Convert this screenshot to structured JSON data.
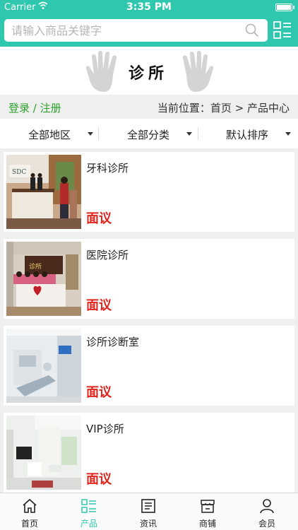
{
  "status_bar": {
    "carrier": "Carrier",
    "time": "3:35 PM"
  },
  "search": {
    "placeholder": "请输入商品关键字"
  },
  "banner": {
    "title": "诊所"
  },
  "breadcrumb": {
    "login_link": "登录",
    "separator": " / ",
    "register_link": "注册",
    "location": "当前位置：首页 > 产品中心"
  },
  "filters": [
    {
      "label": "全部地区"
    },
    {
      "label": "全部分类"
    },
    {
      "label": "默认排序"
    }
  ],
  "products": [
    {
      "name": "牙科诊所",
      "price": "面议"
    },
    {
      "name": "医院诊所",
      "price": "面议"
    },
    {
      "name": "诊所诊断室",
      "price": "面议"
    },
    {
      "name": "VIP诊所",
      "price": "面议"
    }
  ],
  "tabbar": [
    {
      "label": "首页",
      "icon": "home-icon"
    },
    {
      "label": "产品",
      "icon": "product-list-icon",
      "active": true
    },
    {
      "label": "资讯",
      "icon": "news-icon"
    },
    {
      "label": "商铺",
      "icon": "shop-icon"
    },
    {
      "label": "会员",
      "icon": "user-icon"
    }
  ],
  "colors": {
    "accent": "#2fc7ad",
    "price": "#e0241e",
    "link": "#2aa12a"
  }
}
